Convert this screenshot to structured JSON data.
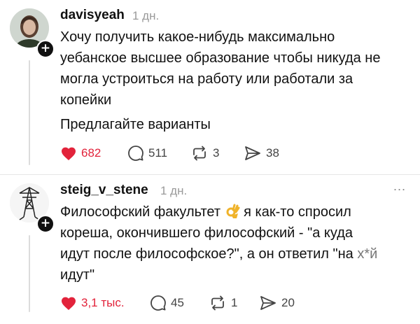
{
  "posts": [
    {
      "username": "davisyeah",
      "time": "1 дн.",
      "paragraph1": "Хочу получить какое-нибудь максимально\nуебанское высшее образование чтобы никуда не\nмогла устроиться на работу или работали за\nкопейки",
      "paragraph2": "Предлагайте варианты",
      "likes": "682",
      "comments": "511",
      "reposts": "3",
      "shares": "38"
    },
    {
      "username": "steig_v_stene",
      "time": "1 дн.",
      "more": "...",
      "line1_before": "Философский факультет",
      "line1_after": "я как-то спросил",
      "lines_rest": "кореша, окончившего философский - \"а куда\nидут после философское?\", а он ответил \"на ",
      "censored": "х*й",
      "lines_end": "\nидут\"",
      "likes": "3,1 тыс.",
      "comments": "45",
      "reposts": "1",
      "shares": "20"
    }
  ],
  "colors": {
    "like": "#e2233b",
    "text": "#111111",
    "muted": "#9a9a9a"
  }
}
